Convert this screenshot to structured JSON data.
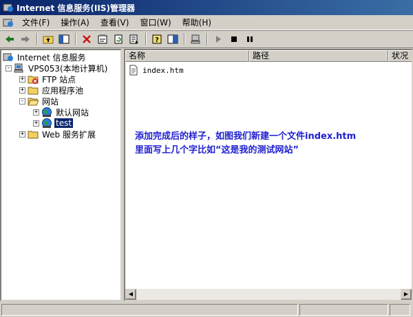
{
  "window": {
    "title": "Internet 信息服务(IIS)管理器"
  },
  "menu": {
    "items": [
      "文件(F)",
      "操作(A)",
      "查看(V)",
      "窗口(W)",
      "帮助(H)"
    ]
  },
  "toolbar": {
    "buttons": [
      "back-icon",
      "forward-icon",
      "up-folder-icon",
      "show-tree-icon",
      "delete-icon",
      "properties-icon",
      "refresh-icon",
      "export-icon",
      "help-icon",
      "console-tree-icon",
      "connect-icon",
      "play-icon",
      "stop-icon",
      "pause-icon"
    ]
  },
  "tree": {
    "root": "Internet 信息服务",
    "server": "VPS053(本地计算机)",
    "ftp": "FTP 站点",
    "app_pools": "应用程序池",
    "websites": "网站",
    "default_site": "默认网站",
    "test_site": "test",
    "web_ext": "Web 服务扩展"
  },
  "list": {
    "columns": [
      "名称",
      "路径",
      "状况"
    ],
    "rows": [
      {
        "name": "index.htm"
      }
    ]
  },
  "annotation": {
    "line1": "添加完成后的样子，如图我们新建一个文件index.htm",
    "line2": "里面写上几个字比如“这是我的测试网站”"
  },
  "colors": {
    "title_bar": "#0a246a",
    "selection": "#0a246a",
    "annotation_text": "#2020d0"
  }
}
